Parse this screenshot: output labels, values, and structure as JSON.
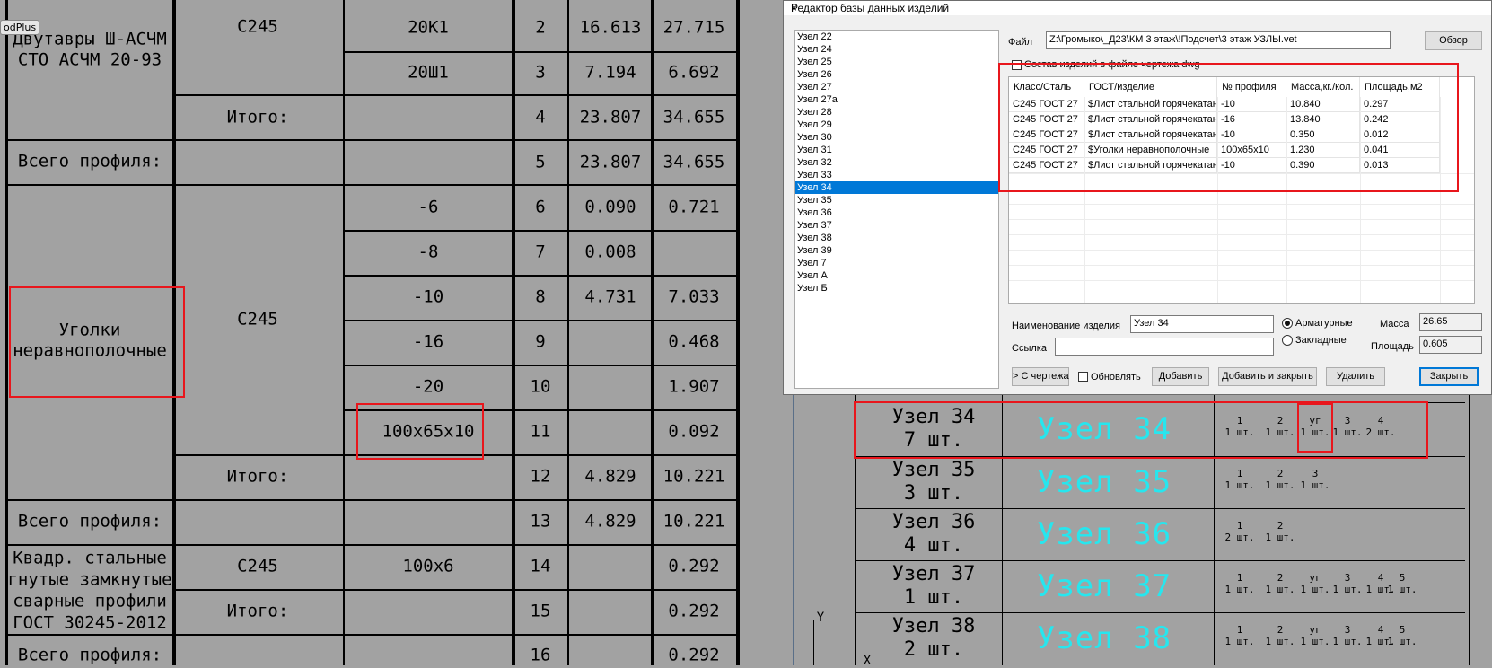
{
  "cad_table": {
    "top_tag": "odPlus",
    "names": {
      "dvutavry": [
        "Двутавры Ш-АСЧМ",
        "СТО АСЧМ 20-93"
      ],
      "ugolki": [
        "Уголки",
        "неравнополочные"
      ],
      "kvadr": [
        "Квадр. стальные",
        "гнутые замкнутые",
        "сварные профили",
        "ГОСТ 30245-2012"
      ]
    },
    "itogo": "Итого:",
    "vsego": "Всего профиля:",
    "steel": "С245",
    "rows": [
      {
        "profile": "20К1",
        "n": "2",
        "mass": "16.613",
        "area": "27.715"
      },
      {
        "profile": "20Ш1",
        "n": "3",
        "mass": "7.194",
        "area": "6.692"
      },
      {
        "profile": "",
        "n": "4",
        "mass": "23.807",
        "area": "34.655"
      },
      {
        "profile": "",
        "n": "5",
        "mass": "23.807",
        "area": "34.655"
      },
      {
        "profile": "-6",
        "n": "6",
        "mass": "0.090",
        "area": "0.721"
      },
      {
        "profile": "-8",
        "n": "7",
        "mass": "0.008",
        "area": ""
      },
      {
        "profile": "-10",
        "n": "8",
        "mass": "4.731",
        "area": "7.033"
      },
      {
        "profile": "-16",
        "n": "9",
        "mass": "",
        "area": "0.468"
      },
      {
        "profile": "-20",
        "n": "10",
        "mass": "",
        "area": "1.907"
      },
      {
        "profile": "100x65x10",
        "n": "11",
        "mass": "",
        "area": "0.092"
      },
      {
        "profile": "",
        "n": "12",
        "mass": "4.829",
        "area": "10.221"
      },
      {
        "profile": "",
        "n": "13",
        "mass": "4.829",
        "area": "10.221"
      },
      {
        "profile": "100x6",
        "n": "14",
        "mass": "",
        "area": "0.292"
      },
      {
        "profile": "",
        "n": "15",
        "mass": "",
        "area": "0.292"
      },
      {
        "profile": "",
        "n": "16",
        "mass": "",
        "area": "0.292"
      }
    ],
    "nodes": [
      {
        "label": "Узел 34",
        "qty": "7 шт.",
        "cyan": "Узел 34",
        "parts": [
          [
            "1",
            "1 шт."
          ],
          [
            "2",
            "1 шт."
          ],
          [
            "уг",
            "1 шт."
          ],
          [
            "3",
            "1 шт."
          ],
          [
            "4",
            "2 шт."
          ]
        ]
      },
      {
        "label": "Узел 35",
        "qty": "3 шт.",
        "cyan": "Узел 35",
        "parts": [
          [
            "1",
            "1 шт."
          ],
          [
            "2",
            "1 шт."
          ],
          [
            "3",
            "1 шт."
          ]
        ]
      },
      {
        "label": "Узел 36",
        "qty": "4 шт.",
        "cyan": "Узел 36",
        "parts": [
          [
            "1",
            "2 шт."
          ],
          [
            "2",
            "1 шт."
          ]
        ]
      },
      {
        "label": "Узел 37",
        "qty": "1 шт.",
        "cyan": "Узел 37",
        "parts": [
          [
            "1",
            "1 шт."
          ],
          [
            "2",
            "1 шт."
          ],
          [
            "уг",
            "1 шт."
          ],
          [
            "3",
            "1 шт."
          ],
          [
            "4",
            "1 шт."
          ],
          [
            "5",
            "1 шт."
          ]
        ]
      },
      {
        "label": "Узел 38",
        "qty": "2 шт.",
        "cyan": "Узел 38",
        "parts": [
          [
            "1",
            "1 шт."
          ],
          [
            "2",
            "1 шт."
          ],
          [
            "уг",
            "1 шт."
          ],
          [
            "3",
            "1 шт."
          ],
          [
            "4",
            "1 шт."
          ],
          [
            "5",
            "1 шт."
          ]
        ]
      }
    ],
    "axis_y": "Y",
    "axis_x": "X"
  },
  "dialog": {
    "title": "Редактор базы данных изделий",
    "close": "×",
    "file_label": "Файл",
    "file_value": "Z:\\Громыко\\_Д23\\КМ 3 этаж\\!Подсчет\\3 этаж УЗЛЫ.vet",
    "browse": "Обзор",
    "drawing_check": "Состав изделий в файле чертежа dwg",
    "list": [
      "Узел 22",
      "Узел 24",
      "Узел 25",
      "Узел 26",
      "Узел 27",
      "Узел 27а",
      "Узел 28",
      "Узел 29",
      "Узел 30",
      "Узел 31",
      "Узел 32",
      "Узел 33",
      "Узел 34",
      "Узел 35",
      "Узел 36",
      "Узел 37",
      "Узел 38",
      "Узел 39",
      "Узел 7",
      "Узел А",
      "Узел Б"
    ],
    "selected": "Узел 34",
    "columns": [
      "Класс/Сталь",
      "ГОСТ/изделие",
      "№ профиля",
      "Масса,кг./кол.",
      "Площадь,м2"
    ],
    "grid_rows": [
      [
        "С245 ГОСТ 27",
        "$Лист стальной горячекатан",
        "-10",
        "10.840",
        "0.297"
      ],
      [
        "С245 ГОСТ 27",
        "$Лист стальной горячекатан",
        "-16",
        "13.840",
        "0.242"
      ],
      [
        "С245 ГОСТ 27",
        "$Лист стальной горячекатан",
        "-10",
        "0.350",
        "0.012"
      ],
      [
        "С245 ГОСТ 27",
        "$Уголки неравнополочные",
        "100x65x10",
        "1.230",
        "0.041"
      ],
      [
        "С245 ГОСТ 27",
        "$Лист стальной горячекатан",
        "-10",
        "0.390",
        "0.013"
      ]
    ],
    "name_label": "Наименование изделия",
    "name_value": "Узел 34",
    "link_label": "Ссылка",
    "link_value": "",
    "radio_armature": "Арматурные",
    "radio_embedded": "Закладные",
    "mass_label": "Масса",
    "mass_value": "26.65",
    "area_label": "Площадь",
    "area_value": "0.605",
    "btn_from_drawing": "> С чертежа",
    "update_label": "Обновлять",
    "btn_add": "Добавить",
    "btn_add_close": "Добавить и закрыть",
    "btn_delete": "Удалить",
    "btn_close": "Закрыть"
  }
}
